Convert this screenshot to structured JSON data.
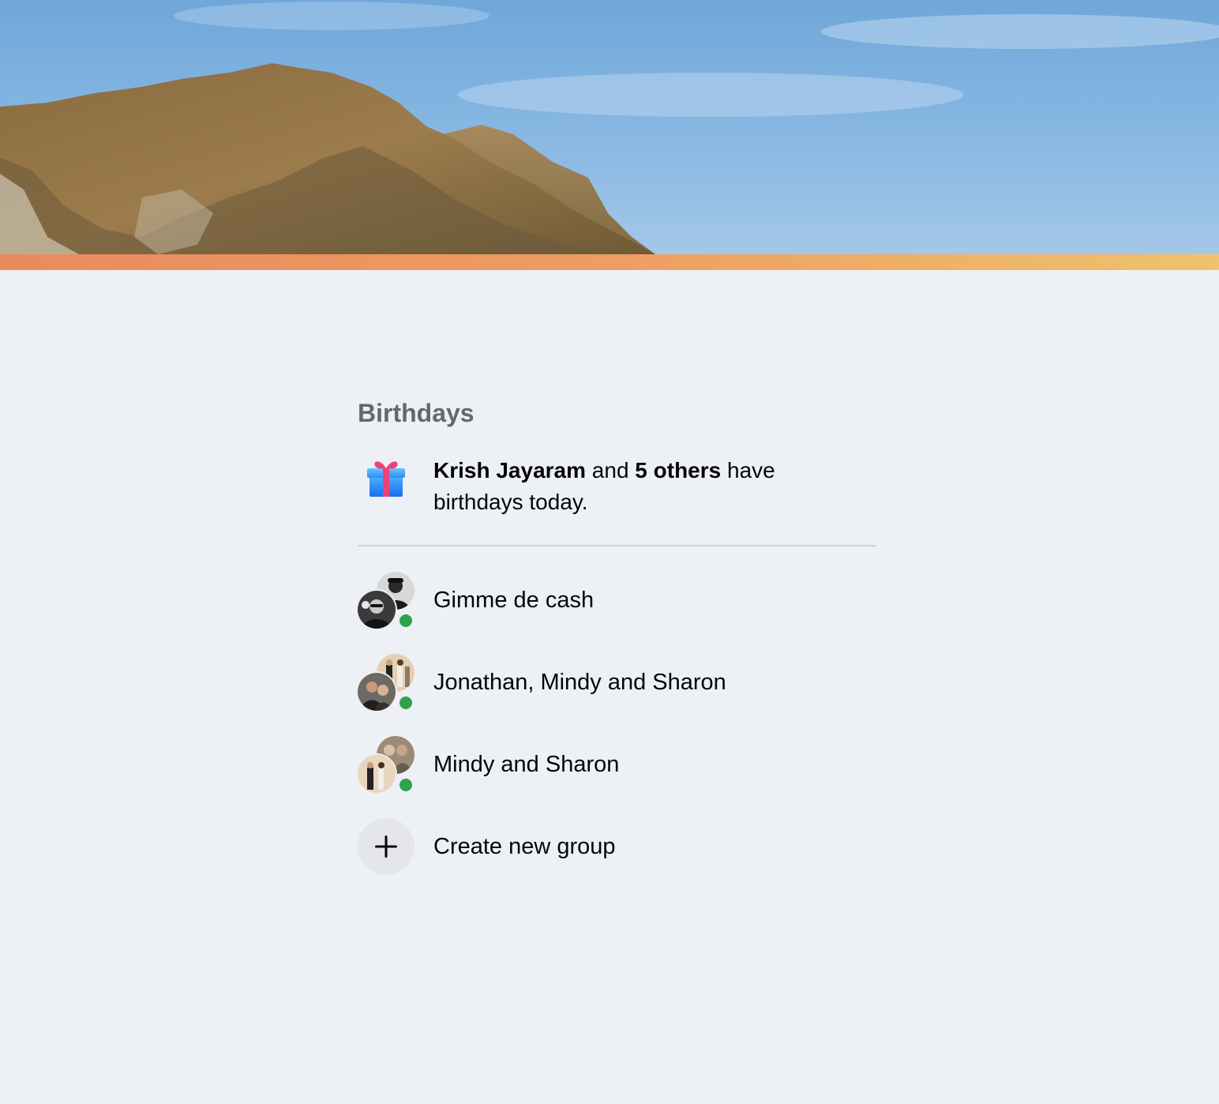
{
  "colors": {
    "background": "#edf0f5",
    "secondary_text": "#65676b",
    "primary_text": "#050505",
    "online": "#31a24c",
    "divider": "#ced0d4",
    "create_button_bg": "#e4e6eb"
  },
  "birthdays": {
    "title": "Birthdays",
    "name": "Krish Jayaram",
    "connector": " and ",
    "others": "5 others",
    "suffix": " have birthdays today.",
    "icon": "gift-icon"
  },
  "groups": [
    {
      "name": "Gimme de cash",
      "online": true
    },
    {
      "name": "Jonathan, Mindy and Sharon",
      "online": true
    },
    {
      "name": "Mindy and Sharon",
      "online": true
    }
  ],
  "create_group": {
    "label": "Create new group",
    "icon": "plus-icon"
  }
}
